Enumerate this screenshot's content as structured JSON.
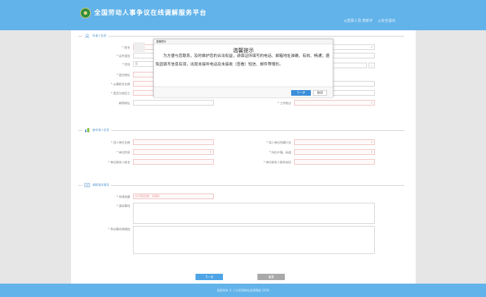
{
  "header": {
    "site_title": "全国劳动人事争议在线调解服务平台",
    "user_label": "◎登录人员:李新宇",
    "logout_label": "◎安全退出"
  },
  "section_applicant": {
    "title": "申请人信息",
    "fields": {
      "name_label": "* 姓名",
      "gender_label": "* 性别",
      "gender_value": "男",
      "id_type_label": "* 证件类型",
      "address_label": "* 居住地址",
      "industry_label": "* 从事职业名称",
      "migrant_label": "* 是否为农民工",
      "mail_label": "邮寄地址",
      "workplace_label": "* 工作地点"
    }
  },
  "section_respondent": {
    "title": "被申请人信息",
    "fields": {
      "unit_name_label": "* 用人单位名称",
      "unit_industry_label": "* 用人单位所属行业",
      "unit_nature_label": "* 单位性质",
      "unit_region_label": "* 所在乡镇、街道",
      "contact_name_label": "* 单位联系人姓名",
      "contact_phone_label": "* 单位联系人联系电话"
    }
  },
  "section_mediation": {
    "title": "调解请求事项",
    "fields": {
      "amount_label": "* 申请金额",
      "amount_placeholder": "仅可填金额，如填0。",
      "request_label": "* 请求事项",
      "reason_label": "* 争议事实和理由"
    }
  },
  "buttons": {
    "next": "下一步",
    "reset": "重置"
  },
  "footer": {
    "copyright": "版权所有 © 人力资源和社会保障部 2018"
  },
  "dialog": {
    "header": "温馨提示",
    "title": "温馨提示",
    "body": "为方便与您联系，及时维护您的合法权益，请保证所填写的电话、邮箱地址准确、有效、畅通；避免因填写信息有误，出现未接听电话及未接收（查看）短信、邮件等情形。",
    "next_button": "下一步",
    "ok_button": "取消"
  },
  "colors": {
    "header_bg": "#62b3ea",
    "accent": "#4ea4e6",
    "required_border": "#f0c4c4"
  }
}
